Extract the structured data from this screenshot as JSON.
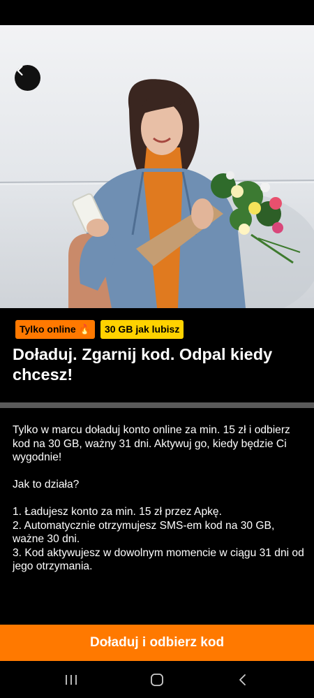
{
  "hero": {
    "back_icon": "chevron-left-icon",
    "photo_subject": "woman-with-phone-and-flowers"
  },
  "badges": [
    {
      "label": "Tylko online 🔥",
      "color": "#ff7900"
    },
    {
      "label": "30 GB jak lubisz",
      "color": "#ffd200"
    }
  ],
  "offer": {
    "title": "Doładuj. Zgarnij kod. Odpal kiedy chcesz!",
    "intro": "Tylko w marcu doładuj konto online za min. 15 zł i odbierz kod na 30 GB, ważny 31 dni. Aktywuj go, kiedy będzie Ci wygodnie!",
    "how_heading": "Jak to działa?",
    "steps": [
      "1. Ładujesz konto za min. 15 zł przez Apkę.",
      "2. Automatycznie otrzymujesz SMS-em kod na 30 GB, ważne 30 dni.",
      "3. Kod aktywujesz w dowolnym momencie w ciągu 31 dni od jego otrzymania."
    ]
  },
  "cta": {
    "label": "Doładuj i odbierz kod",
    "color": "#ff7900"
  },
  "nav": {
    "recents_icon": "recents-icon",
    "home_icon": "home-icon",
    "back_icon": "back-chevron-icon"
  }
}
